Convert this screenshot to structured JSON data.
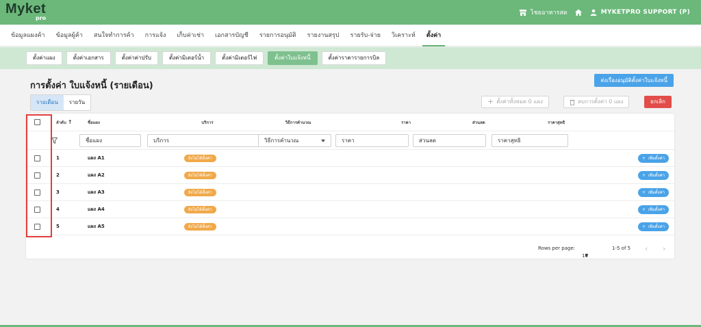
{
  "brand": {
    "name": "Myket",
    "sub": "pro"
  },
  "topbar": {
    "shop_name": "ไชยอาหารสด",
    "user_label": "MYKETPRO SUPPORT (P)"
  },
  "menu": [
    {
      "label": "ข้อมูลแผงค้า"
    },
    {
      "label": "ข้อมูลผู้ค้า"
    },
    {
      "label": "สนใจทำการค้า"
    },
    {
      "label": "การแจ้ง"
    },
    {
      "label": "เก็บค่าเช่า"
    },
    {
      "label": "เอกสารบัญชี"
    },
    {
      "label": "รายการอนุมัติ"
    },
    {
      "label": "รายงานสรุป"
    },
    {
      "label": "รายรับ-จ่าย"
    },
    {
      "label": "วิเคราะห์"
    },
    {
      "label": "ตั้งค่า"
    }
  ],
  "submenu": [
    {
      "label": "ตั้งค่าแผง"
    },
    {
      "label": "ตั้งค่าเอกสาร"
    },
    {
      "label": "ตั้งค่าค่าปรับ"
    },
    {
      "label": "ตั้งค่ามิเตอร์น้ำ"
    },
    {
      "label": "ตั้งค่ามิเตอร์ไฟ"
    },
    {
      "label": "ตั้งค่าใบแจ้งหนี้"
    },
    {
      "label": "ตั้งค่าราคารายการบิล"
    }
  ],
  "page": {
    "title": "การตั้งค่า ใบแจ้งหนี้ (รายเดือน)",
    "send_approval": "ส่งเรื่องอนุมัติตั้งค่าใบแจ้งหนี้",
    "toggle": [
      "รายเดือน",
      "รายวัน"
    ],
    "set_all": "ตั้งค่าทั้งหมด 0 แผง",
    "delete_settings": "ลบการตั้งค่า 0 แผง",
    "cancel": "ยกเลิก"
  },
  "table": {
    "headers": {
      "index": "ลำดับ",
      "sort_arrow": "↑",
      "stall": "ชื่อแผง",
      "service": "บริการ",
      "calc": "วิธีการคำนวณ",
      "price": "ราคา",
      "discount": "ส่วนลด",
      "net": "ราคาสุทธิ"
    },
    "filters": {
      "stall": "ชื่อแผง",
      "service": "บริการ",
      "calc": "วิธีการคำนวณ",
      "price": "ราคา",
      "discount": "ส่วนลด",
      "net": "ราคาสุทธิ"
    },
    "status_label": "ยังไม่ได้ตั้งค่า",
    "add_label": "เพิ่มตั้งค่า",
    "rows": [
      {
        "index": "1",
        "stall": "แผง A1"
      },
      {
        "index": "2",
        "stall": "แผง A2"
      },
      {
        "index": "3",
        "stall": "แผง A3"
      },
      {
        "index": "4",
        "stall": "แผง A4"
      },
      {
        "index": "5",
        "stall": "แผง A5"
      }
    ],
    "pagination": {
      "rows_per_page_label": "Rows per page:",
      "rows_per_page": "10",
      "range": "1-5 of 5"
    }
  }
}
